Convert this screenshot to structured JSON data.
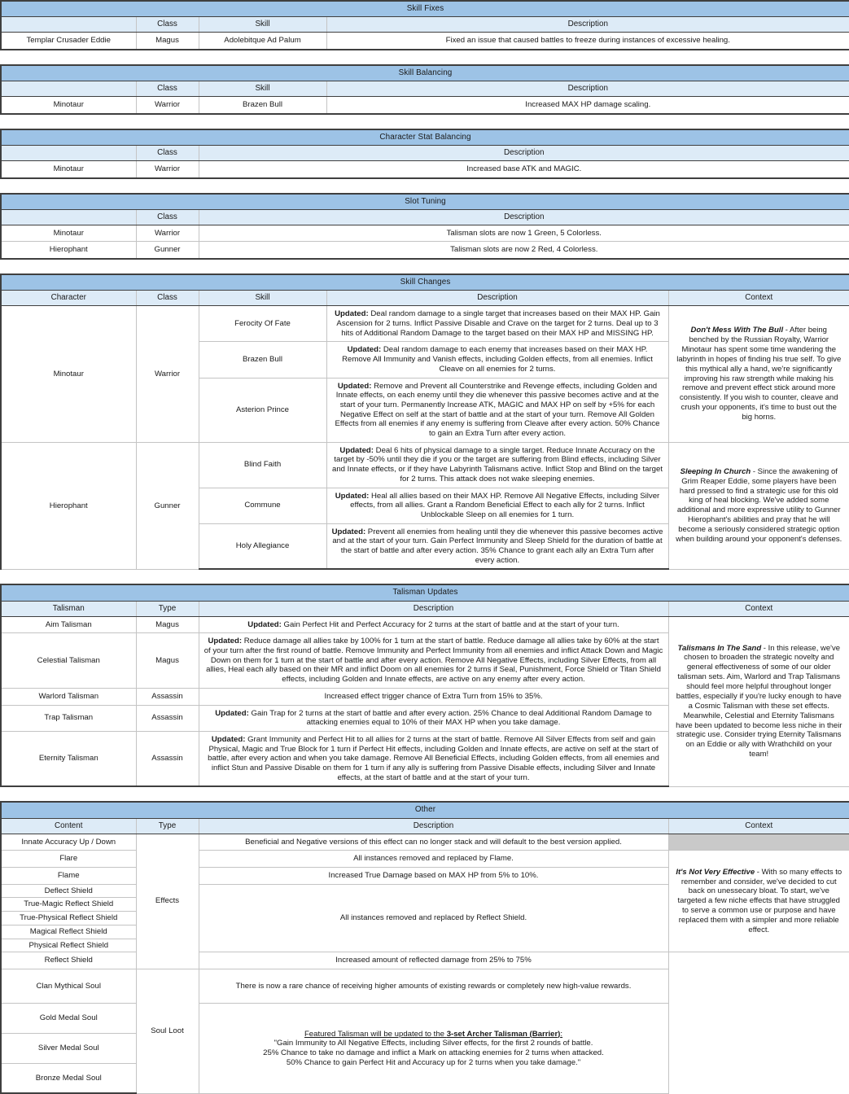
{
  "sections": [
    {
      "id": "skill-fixes",
      "title": "Skill Fixes",
      "headers": [
        "",
        "Class",
        "Skill",
        "Description"
      ],
      "rows": [
        [
          "Templar Crusader Eddie",
          "Magus",
          "Adolebitque Ad Palum",
          "Fixed an issue that caused battles to freeze during instances of excessive healing."
        ]
      ]
    },
    {
      "id": "skill-balancing",
      "title": "Skill Balancing",
      "headers": [
        "",
        "Class",
        "Skill",
        "Description"
      ],
      "rows": [
        [
          "Minotaur",
          "Warrior",
          "Brazen Bull",
          "Increased MAX HP damage scaling."
        ]
      ]
    },
    {
      "id": "character-stat-balancing",
      "title": "Character Stat Balancing",
      "headers": [
        "",
        "Class",
        "Description"
      ],
      "rows": [
        [
          "Minotaur",
          "Warrior",
          "Increased base ATK and MAGIC."
        ]
      ]
    },
    {
      "id": "slot-tuning",
      "title": "Slot Tuning",
      "headers": [
        "",
        "Class",
        "Description"
      ],
      "rows": [
        [
          "Minotaur",
          "Warrior",
          "Talisman slots are now 1 Green, 5 Colorless."
        ],
        [
          "Hierophant",
          "Gunner",
          "Talisman slots are now 2 Red, 4 Colorless."
        ]
      ]
    }
  ],
  "skill_changes": {
    "title": "Skill Changes",
    "headers": [
      "Character",
      "Class",
      "Skill",
      "Description",
      "Context"
    ],
    "groups": [
      {
        "character": "Minotaur",
        "class": "Warrior",
        "context_title": "Don't Mess With The Bull",
        "context_body": " - After being benched by the Russian Royalty, Warrior Minotaur has spent some time wandering the labyrinth in hopes of finding his true self. To give this mythical ally a hand, we're significantly improving his raw strength while making his remove and prevent effect stick around more consistently. If you wish to counter, cleave and crush your opponents, it's time to bust out the big horns.",
        "skills": [
          {
            "name": "Ferocity Of Fate",
            "label": "Updated:",
            "text": " Deal random damage to a single target that increases based on their MAX HP. Gain Ascension for 2 turns. Inflict Passive Disable and Crave on the target for 2 turns. Deal up to 3 hits of Additional Random Damage to the target based on their MAX HP and MISSING HP."
          },
          {
            "name": "Brazen Bull",
            "label": "Updated:",
            "text": " Deal random damage to each enemy that increases based on their MAX HP. Remove All Immunity and Vanish effects, including Golden effects, from all enemies. Inflict Cleave on all enemies for 2 turns."
          },
          {
            "name": "Asterion Prince",
            "label": "Updated:",
            "text": " Remove and Prevent all Counterstrike and Revenge effects, including Golden and Innate effects, on each enemy until they die whenever this passive becomes active and at the start of your turn. Permanently Increase ATK, MAGIC and MAX HP on self by +5% for each Negative Effect on self at the start of battle and at the start of your turn. Remove All Golden Effects from all enemies if any enemy is suffering from Cleave after every action. 50% Chance to gain an Extra Turn after every action."
          }
        ]
      },
      {
        "character": "Hierophant",
        "class": "Gunner",
        "context_title": "Sleeping In Church",
        "context_body": " - Since the awakening of Grim Reaper Eddie, some players have been hard pressed to find a strategic use for this old king of heal blocking. We've added some additional and more expressive utility to Gunner Hierophant's abilities and pray that he will become a seriously considered strategic option when building around your opponent's defenses.",
        "skills": [
          {
            "name": "Blind Faith",
            "label": "Updated:",
            "text": " Deal 6 hits of physical damage to a single target. Reduce Innate Accuracy on the target by -50% until they die if you or the target are suffering from Blind effects, including Silver and Innate effects, or if they have Labyrinth Talismans active. Inflict Stop and Blind on the target for 2 turns. This attack does not wake sleeping enemies."
          },
          {
            "name": "Commune",
            "label": "Updated:",
            "text": " Heal all allies based on their MAX HP. Remove All Negative Effects, including Silver effects, from all allies. Grant a Random Beneficial Effect to each ally for 2 turns. Inflict Unblockable Sleep on all enemies for 1 turn."
          },
          {
            "name": "Holy Allegiance",
            "label": "Updated:",
            "text": " Prevent all enemies from healing until they die whenever this passive becomes active and at the start of your turn. Gain Perfect Immunity and Sleep Shield for the duration of battle at the start of battle and after every action. 35% Chance to grant each ally an Extra Turn after every action."
          }
        ]
      }
    ]
  },
  "talisman_updates": {
    "title": "Talisman Updates",
    "headers": [
      "Talisman",
      "Type",
      "Description",
      "Context"
    ],
    "context_title": "Talismans In The Sand",
    "context_body": " - In this release, we've chosen to broaden the strategic novelty and general effectiveness of some of our older talisman sets. Aim, Warlord and Trap Talismans should feel more helpful throughout longer battles, especially if you're lucky enough to have a Cosmic Talisman with these set effects. Meanwhile, Celestial and Eternity Talismans have been updated to become less niche in their strategic use. Consider trying Eternity Talismans on an Eddie or ally with Wrathchild on your team!",
    "rows": [
      {
        "name": "Aim Talisman",
        "type": "Magus",
        "label": "Updated:",
        "text": " Gain Perfect Hit and Perfect Accuracy for 2 turns at the start of battle and at the start of your turn."
      },
      {
        "name": "Celestial Talisman",
        "type": "Magus",
        "label": "Updated:",
        "text": " Reduce damage all allies take by 100% for 1 turn at the start of battle. Reduce damage all allies take by 60% at the start of your turn after the first round of battle. Remove Immunity and Perfect Immunity from all enemies and inflict Attack Down and Magic Down on them for 1 turn at the start of battle and after every action. Remove All Negative Effects, including Silver Effects, from all allies, Heal each ally based on their MR and inflict Doom on all enemies for 2 turns if Seal, Punishment, Force Shield or Titan Shield effects, including Golden and Innate effects, are active on any enemy after every action."
      },
      {
        "name": "Warlord Talisman",
        "type": "Assassin",
        "label": "",
        "text": "Increased effect trigger chance of Extra Turn from 15% to 35%."
      },
      {
        "name": "Trap Talisman",
        "type": "Assassin",
        "label": "Updated:",
        "text": " Gain Trap for 2 turns at the start of battle and after every action. 25% Chance to deal Additional Random Damage to attacking enemies equal to 10% of their MAX HP when you take damage."
      },
      {
        "name": "Eternity Talisman",
        "type": "Assassin",
        "label": "Updated:",
        "text": " Grant Immunity and Perfect Hit to all allies for 2 turns at the start of battle. Remove All Silver Effects from self and gain Physical, Magic and True Block for 1 turn if Perfect Hit effects, including Golden and Innate effects, are active on self at the start of battle, after every action and when you take damage. Remove All Beneficial Effects, including Golden effects, from all enemies and inflict Stun and Passive Disable on them for 1 turn if any ally is suffering from Passive Disable effects, including Silver and Innate effects, at the start of battle and at the start of your turn."
      }
    ]
  },
  "other": {
    "title": "Other",
    "headers": [
      "Content",
      "Type",
      "Description",
      "Context"
    ],
    "context_title": "It's Not Very Effective",
    "context_body": " - With so many effects to remember and consider, we've decided to cut back on unessecary bloat. To start, we've targeted a few niche effects that have struggled to serve a common use or purpose and have replaced them with a simpler and more reliable effect.",
    "effects_type": "Effects",
    "soul_type": "Soul Loot",
    "effects_rows": [
      {
        "content": "Innate Accuracy Up / Down",
        "desc": "Beneficial and Negative versions of this effect can no longer stack and will default to the best version applied."
      },
      {
        "content": "Flare",
        "desc": "All instances removed and replaced by Flame."
      },
      {
        "content": "Flame",
        "desc": "Increased True Damage based on MAX HP from 5% to 10%."
      },
      {
        "content": "Deflect Shield",
        "desc": null
      },
      {
        "content": "True-Magic Reflect Shield",
        "desc": null
      },
      {
        "content": "True-Physical Reflect Shield",
        "desc": null
      },
      {
        "content": "Magical Reflect Shield",
        "desc": null
      },
      {
        "content": "Physical Reflect Shield",
        "desc": null
      },
      {
        "content": "Reflect Shield",
        "desc": "Increased amount of reflected damage from 25% to 75%"
      }
    ],
    "merged_effects_desc": "All instances removed and replaced by Reflect Shield.",
    "soul_rows": [
      {
        "content": "Clan Mythical Soul"
      },
      {
        "content": "Gold Medal Soul"
      },
      {
        "content": "Silver Medal Soul"
      },
      {
        "content": "Bronze Medal Soul"
      }
    ],
    "clan_desc": "There is now a rare chance of receiving higher amounts of existing rewards or completely new high-value rewards.",
    "medal_desc": {
      "line1_pre": "Featured Talisman will be updated to the ",
      "line1_bold": "3-set Archer Talisman (Barrier)",
      "line1_post": ":",
      "line2": "\"Gain Immunity to All Negative Effects, including Silver effects, for the first 2 rounds of battle.",
      "line3": "25% Chance to take no damage and inflict a Mark on attacking enemies for 2 turns when attacked.",
      "line4": "50% Chance to gain Perfect Hit and Accuracy up for 2 turns when you take damage.\""
    }
  },
  "colors": {
    "section_header": "#9dc3e6",
    "column_header": "#ddebf7",
    "gray_cell": "#c9c9c9",
    "border": "#3f3f3f"
  }
}
